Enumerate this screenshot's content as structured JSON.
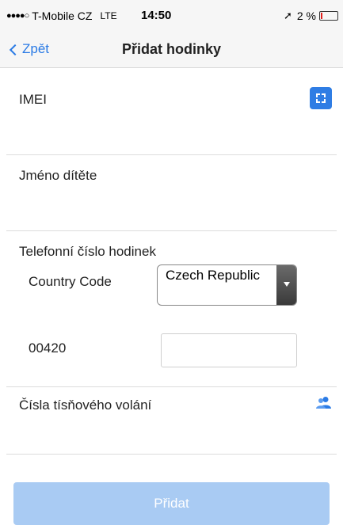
{
  "status_bar": {
    "signal": "●●●●○",
    "carrier": "T-Mobile CZ",
    "network": "LTE",
    "time": "14:50",
    "location_icon": "location-arrow-icon",
    "battery": "2 %"
  },
  "nav": {
    "back_label": "Zpět",
    "title": "Přidat hodinky"
  },
  "form": {
    "imei_label": "IMEI",
    "child_name_label": "Jméno dítěte",
    "watch_phone_label": "Telefonní číslo hodinek",
    "country_code_label": "Country Code",
    "country_selected": "Czech Republic",
    "dial_prefix": "00420",
    "phone_value": "",
    "emergency_label": "Čísla tísňového volání"
  },
  "icons": {
    "scan": "qr-scan-icon",
    "contacts": "contacts-icon"
  },
  "colors": {
    "accent": "#2b7be5",
    "button_disabled": "#a9cbf3"
  },
  "actions": {
    "submit_label": "Přidat"
  }
}
